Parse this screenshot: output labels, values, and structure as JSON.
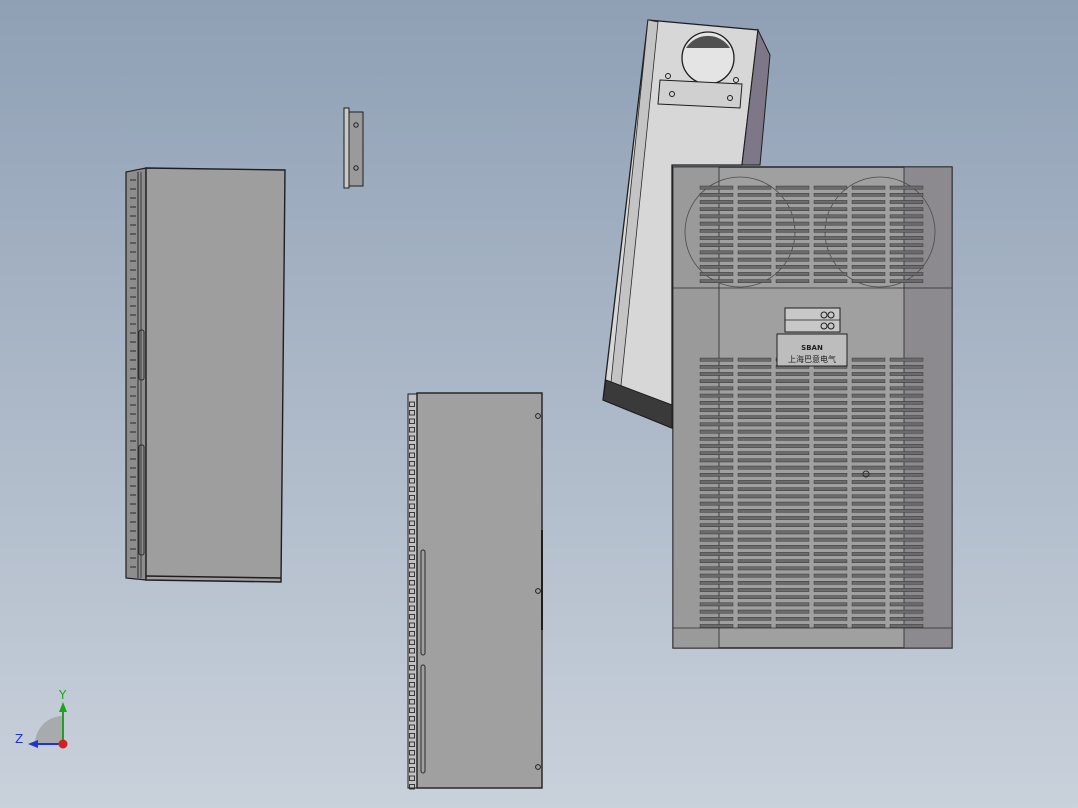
{
  "triad": {
    "y_label": "Y",
    "z_label": "Z"
  },
  "nameplate": {
    "brand": "SBAN",
    "company": "上海巴意电气"
  },
  "colors": {
    "background_top": "#8fa0b5",
    "background_bottom": "#c9d1db",
    "part_face": "#9d9d9d",
    "part_dark": "#8a8a8a",
    "part_light": "#d9d9d9",
    "edge": "#1e1e1e",
    "axis_x": "#d42020",
    "axis_y": "#1fa31f",
    "axis_z": "#2136c9"
  }
}
